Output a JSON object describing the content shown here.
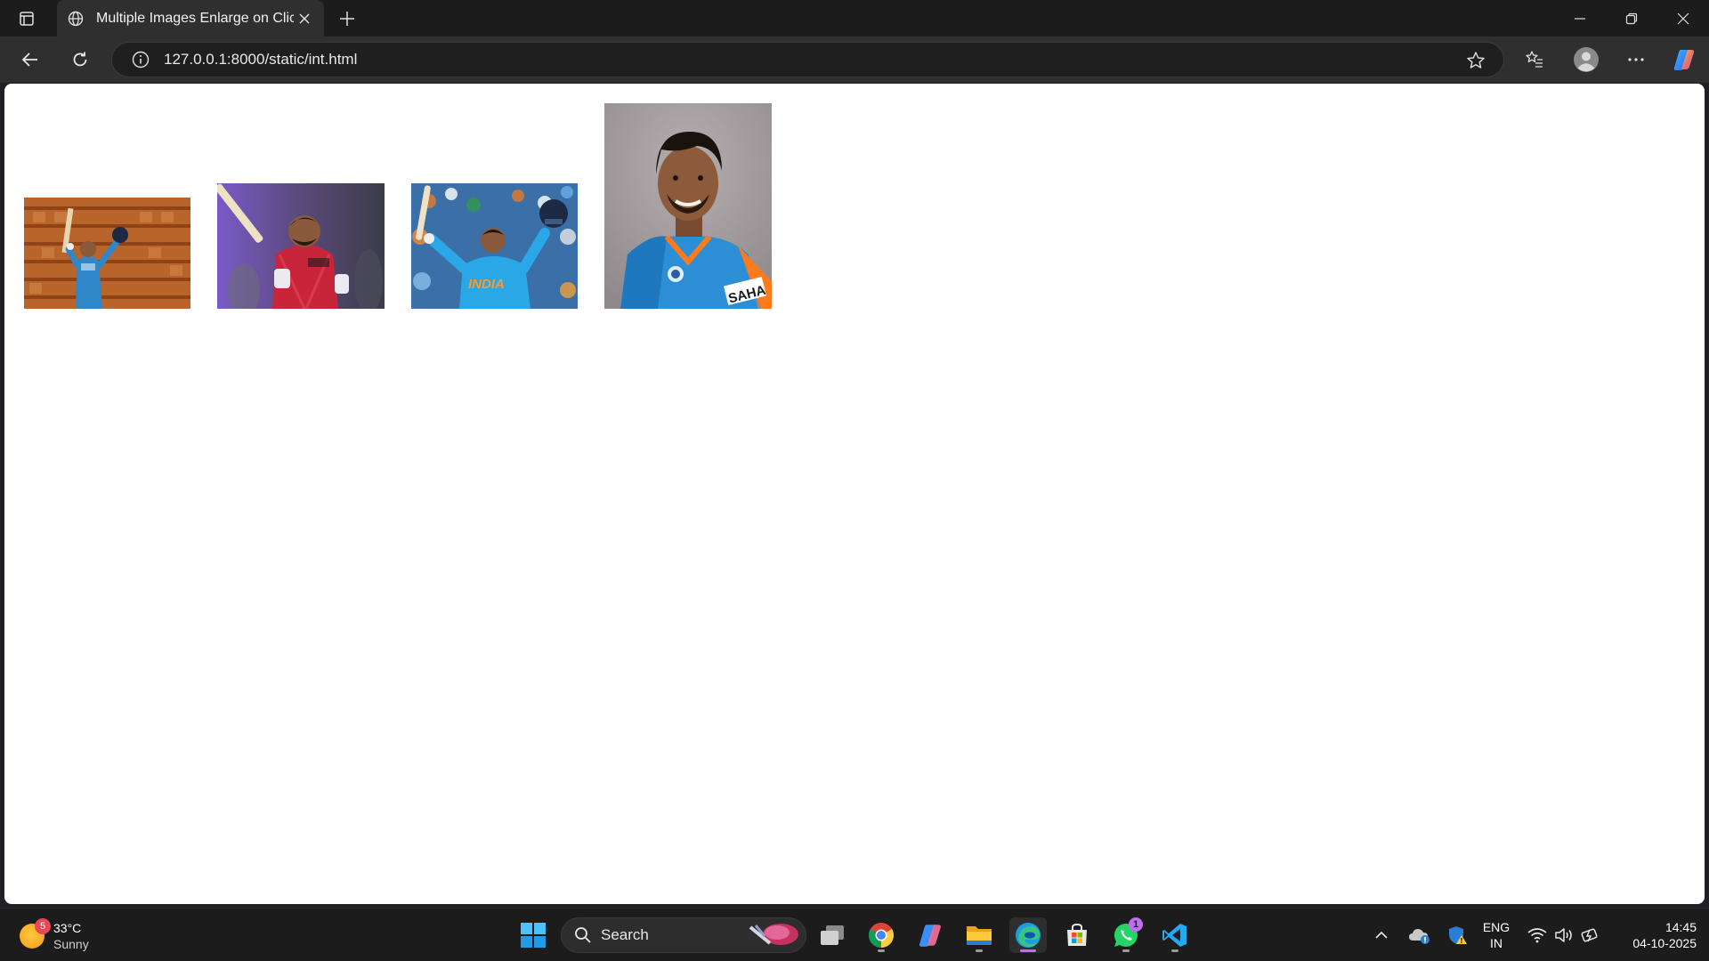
{
  "browser": {
    "tab_title": "Multiple Images Enlarge on Click",
    "url": "127.0.0.1:8000/static/int.html"
  },
  "page": {
    "images": [
      {
        "subject": "cricketer in blue India jersey raising bat and helmet"
      },
      {
        "subject": "cricketer in red jersey celebrating with bat"
      },
      {
        "subject": "cricketer in light blue INDIA jersey raising bat and helmet"
      },
      {
        "subject": "portrait of smiling cricketer in blue India jersey"
      }
    ],
    "jersey_text_1": "INDIA",
    "jersey_text_2": "SAHA"
  },
  "taskbar": {
    "weather_badge": "5",
    "temperature": "33°C",
    "condition": "Sunny",
    "search_label": "Search",
    "whatsapp_badge": "1",
    "language_line1": "ENG",
    "language_line2": "IN",
    "time": "14:45",
    "date": "04-10-2025"
  },
  "colors": {
    "accent_edge": "#0c59a4",
    "taskbar_active": "#c36df4"
  }
}
